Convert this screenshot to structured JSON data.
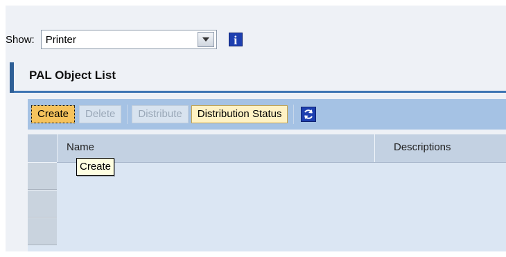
{
  "show_filter": {
    "label": "Show:",
    "selected_value": "Printer",
    "dropdown_icon": "chevron-down-icon",
    "info_icon": "info-icon",
    "info_glyph": "i"
  },
  "section": {
    "title": "PAL Object List"
  },
  "toolbar": {
    "create_label": "Create",
    "delete_label": "Delete",
    "distribute_label": "Distribute",
    "distribution_status_label": "Distribution Status",
    "refresh_icon": "refresh-icon"
  },
  "table": {
    "columns": [
      "Name",
      "Descriptions"
    ],
    "rows": []
  },
  "tooltip": {
    "text": "Create"
  },
  "colors": {
    "toolbar_bg": "#a5c2e4",
    "create_highlight": "#f6c35d",
    "section_accent": "#2e5f96"
  }
}
